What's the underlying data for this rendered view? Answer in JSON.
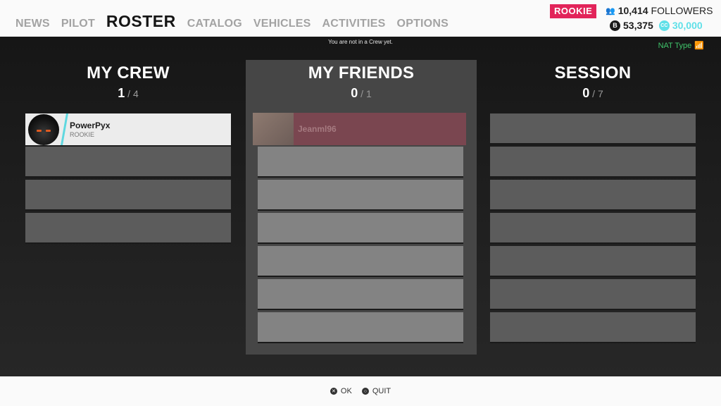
{
  "nav": {
    "items": [
      "NEWS",
      "PILOT",
      "ROSTER",
      "CATALOG",
      "VEHICLES",
      "ACTIVITIES",
      "OPTIONS"
    ],
    "active": "ROSTER"
  },
  "profile": {
    "rank": "ROOKIE",
    "followers_count": "10,414",
    "followers_label": "FOLLOWERS",
    "bucks": "53,375",
    "crew_credits": "30,000"
  },
  "colors": {
    "accent_pink": "#e2245a",
    "accent_cyan": "#5fe0e8",
    "nat_green": "#3fc46a"
  },
  "notice": "You are not in a Crew yet.",
  "nat_label": "NAT Type",
  "columns": {
    "crew": {
      "title": "MY CREW",
      "current": "1",
      "max": "4",
      "members": [
        {
          "name": "PowerPyx",
          "rank": "ROOKIE"
        }
      ],
      "slots": 4
    },
    "friends": {
      "title": "MY FRIENDS",
      "current": "0",
      "max": "1",
      "members": [
        {
          "name": "Jeanml96"
        }
      ],
      "slots": 7
    },
    "session": {
      "title": "SESSION",
      "current": "0",
      "max": "7",
      "slots": 7
    }
  },
  "footer": {
    "ok_label": "OK",
    "quit_label": "QUIT"
  }
}
